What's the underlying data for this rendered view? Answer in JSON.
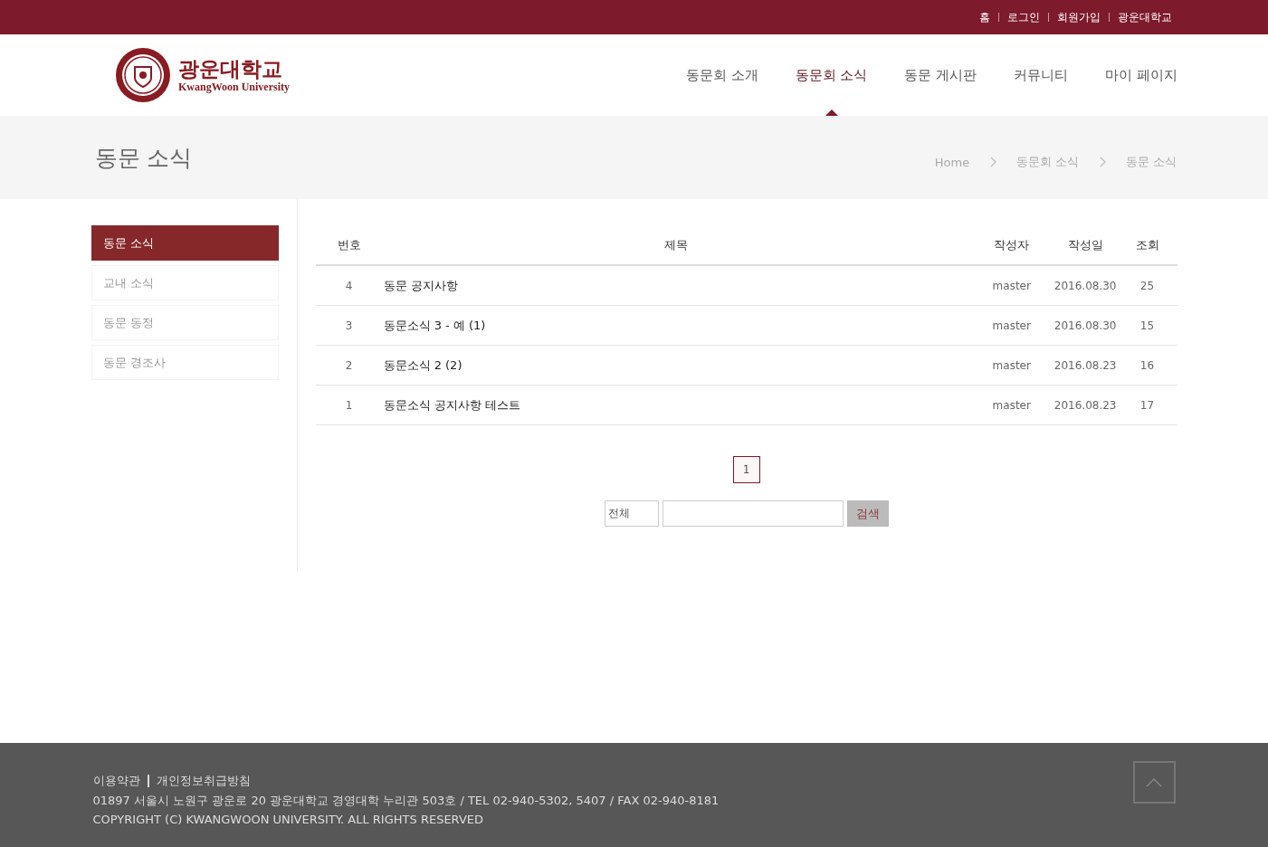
{
  "top_links": [
    "홈",
    "로그인",
    "회원가입",
    "광운대학교"
  ],
  "logo": {
    "name_ko": "광운대학교",
    "name_en": "KwangWoon University"
  },
  "nav": [
    {
      "label": "동문회 소개",
      "selected": false
    },
    {
      "label": "동문회 소식",
      "selected": true
    },
    {
      "label": "동문 게시판",
      "selected": false
    },
    {
      "label": "커뮤니티",
      "selected": false
    },
    {
      "label": "마이 페이지",
      "selected": false
    }
  ],
  "page_title": "동문 소식",
  "breadcrumb": [
    "Home",
    "동문회 소식",
    "동문 소식"
  ],
  "sidebar": {
    "items": [
      {
        "label": "동문 소식",
        "selected": true
      },
      {
        "label": "교내 소식",
        "selected": false
      },
      {
        "label": "동문 동정",
        "selected": false
      },
      {
        "label": "동문 경조사",
        "selected": false
      }
    ]
  },
  "table": {
    "columns": [
      "번호",
      "제목",
      "작성자",
      "작성일",
      "조회"
    ],
    "rows": [
      [
        "4",
        "동문 공지사항",
        "master",
        "2016.08.30",
        "25"
      ],
      [
        "3",
        "동문소식 3 - 예 (1)",
        "master",
        "2016.08.30",
        "15"
      ],
      [
        "2",
        "동문소식 2 (2)",
        "master",
        "2016.08.23",
        "16"
      ],
      [
        "1",
        "동문소식 공지사항 테스트",
        "master",
        "2016.08.23",
        "17"
      ]
    ]
  },
  "pagination": [
    {
      "label": "1",
      "selected": true
    }
  ],
  "search": {
    "scope": "전체",
    "button": "검색"
  },
  "footer": {
    "links": [
      "이용약관",
      "개인정보취급방침"
    ],
    "address": "01897 서울시 노원구 광운로 20 광운대학교 경영대학 누리관 503호 / TEL 02-940-5302, 5407 / FAX 02-940-8181",
    "copyright": "COPYRIGHT (C) KWANGWOON UNIVERSITY. ALL RIGHTS RESERVED"
  }
}
